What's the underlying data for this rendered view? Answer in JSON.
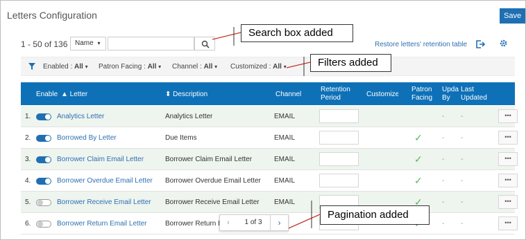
{
  "page": {
    "title": "Letters Configuration",
    "save_label": "Save",
    "count_text": "1 - 50 of 136",
    "search_field": "Name",
    "search_value": "",
    "restore_label": "Restore letters' retention table"
  },
  "filters": [
    {
      "label": "Enabled :",
      "value": "All"
    },
    {
      "label": "Patron Facing :",
      "value": "All"
    },
    {
      "label": "Channel :",
      "value": "All"
    },
    {
      "label": "Customized :",
      "value": "All"
    }
  ],
  "columns": {
    "enable": "Enable",
    "letter": "▲ Letter",
    "description": "⬍ Description",
    "channel": "Channel",
    "retention": "Retention\nPeriod",
    "customized": "Customized",
    "patron_facing": "Patron\nFacing",
    "updated_by": "Upda\nBy",
    "last_updated": "Last\nUpdated"
  },
  "rows": [
    {
      "index": "1.",
      "enabled": true,
      "letter": "Analytics Letter",
      "description": "Analytics Letter",
      "channel": "EMAIL",
      "patron_facing": false,
      "updated_by": "-",
      "last_updated": "-"
    },
    {
      "index": "2.",
      "enabled": true,
      "letter": "Borrowed By Letter",
      "description": "Due Items",
      "channel": "EMAIL",
      "patron_facing": true,
      "updated_by": "-",
      "last_updated": "-"
    },
    {
      "index": "3.",
      "enabled": true,
      "letter": "Borrower Claim Email Letter",
      "description": "Borrower Claim Email Letter",
      "channel": "EMAIL",
      "patron_facing": true,
      "updated_by": "-",
      "last_updated": "-"
    },
    {
      "index": "4.",
      "enabled": true,
      "letter": "Borrower Overdue Email Letter",
      "description": "Borrower Overdue Email Letter",
      "channel": "EMAIL",
      "patron_facing": true,
      "updated_by": "-",
      "last_updated": "-"
    },
    {
      "index": "5.",
      "enabled": false,
      "letter": "Borrower Receive Email Letter",
      "description": "Borrower Receive Email Letter",
      "channel": "EMAIL",
      "patron_facing": true,
      "updated_by": "-",
      "last_updated": "-"
    },
    {
      "index": "6.",
      "enabled": false,
      "letter": "Borrower Return Email Letter",
      "description": "Borrower Return E",
      "channel": "IL",
      "patron_facing": true,
      "updated_by": "-",
      "last_updated": "-"
    }
  ],
  "pagination": {
    "text": "1 of 3",
    "prev_icon": "‹",
    "next_icon": "›"
  },
  "annotations": {
    "search": "Search box added",
    "filters": "Filters added",
    "pagination": "Pagination added"
  },
  "colors": {
    "header_bg": "#0e71b8",
    "link": "#2f6fb2",
    "check": "#5bb55b",
    "save_bg": "#1f6fb2"
  }
}
